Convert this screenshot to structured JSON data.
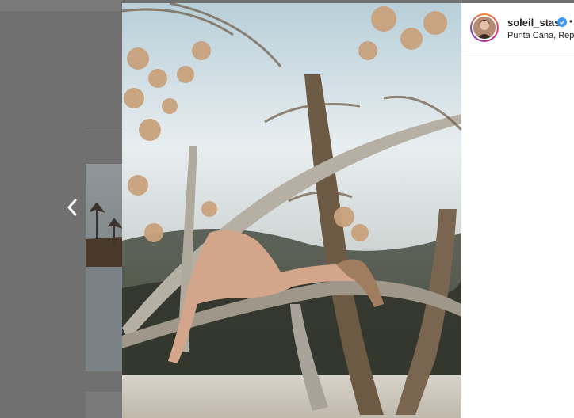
{
  "post": {
    "username": "soleil_stasi",
    "separator": "•",
    "location": "Punta Cana, Repú",
    "verified": true,
    "verified_icon": "verified-badge-icon",
    "avatar_icon": "profile-avatar"
  },
  "navigation": {
    "prev_icon": "chevron-left-icon"
  },
  "colors": {
    "overlay": "#707070",
    "panel_bg": "#ffffff",
    "verified_blue": "#3897f0",
    "text": "#262626"
  }
}
